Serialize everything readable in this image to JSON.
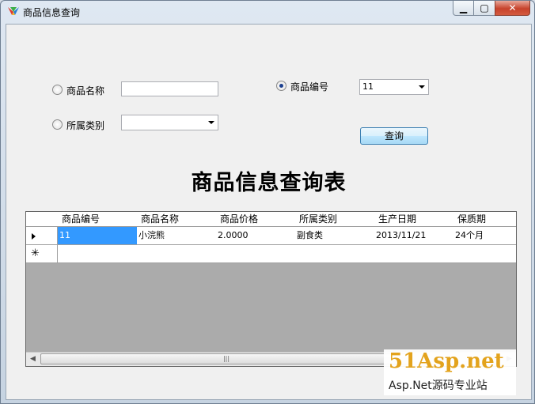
{
  "window": {
    "title": "商品信息查询"
  },
  "form": {
    "radio_name_label": "商品名称",
    "name_value": "",
    "radio_category_label": "所属类别",
    "category_value": "",
    "radio_code_label": "商品编号",
    "code_value": "11",
    "selected_radio": "商品编号",
    "query_button": "查询"
  },
  "heading": "商品信息查询表",
  "grid": {
    "columns": [
      "商品编号",
      "商品名称",
      "商品价格",
      "所属类别",
      "生产日期",
      "保质期"
    ],
    "rows": [
      [
        "11",
        "小浣熊",
        "2.0000",
        "副食类",
        "2013/11/21",
        "24个月"
      ]
    ],
    "new_row_marker": "✳"
  },
  "watermark": {
    "brand": "51Asp.net",
    "tagline": "Asp.Net源码专业站"
  },
  "colors": {
    "selection": "#3399ff",
    "grid_background": "#ababab",
    "watermark": "#e3a31d"
  }
}
